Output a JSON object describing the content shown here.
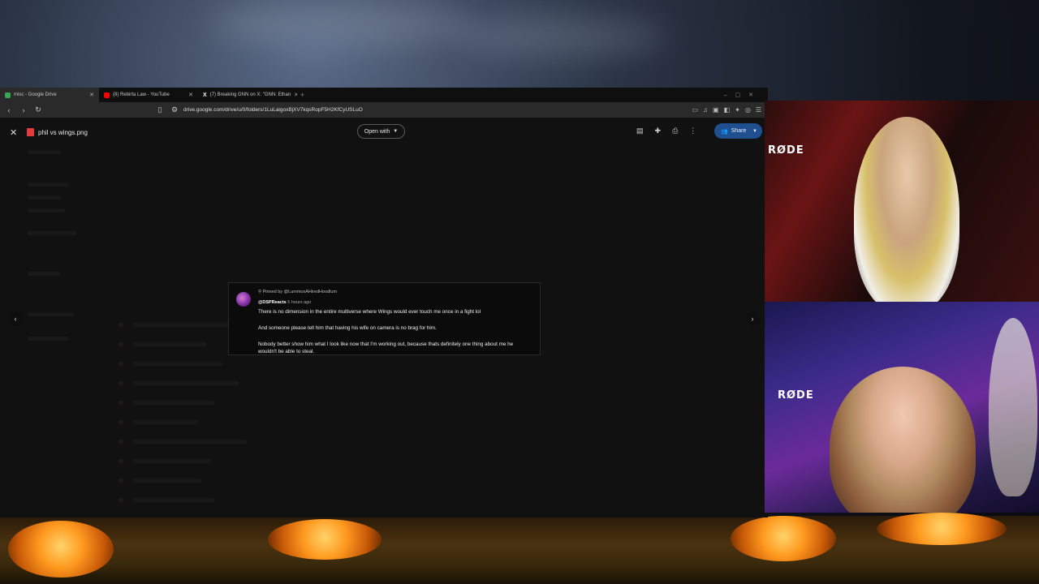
{
  "tabs": [
    {
      "label": "misc - Google Drive",
      "active": true,
      "favicon_color": "#34a853"
    },
    {
      "label": "(8) Rebirta Law - YouTube",
      "active": false,
      "favicon_color": "#ff0000"
    },
    {
      "label": "(7) Breaking GNN on X: \"GNN: Ethan",
      "active": false,
      "favicon_color": "#ffffff"
    }
  ],
  "address": {
    "url": "drive.google.com/drive/u/0/folders/1LuLaigoxBjXV7kqsRopF5H2KfCyUSLuO"
  },
  "preview": {
    "file_name": "phil vs wings.png",
    "open_with_label": "Open with",
    "share_label": "Share"
  },
  "comment": {
    "pinned_by": "Pinned by @LummoxAHiredHoodlum",
    "author": "@DSPReacts",
    "time": "5 hours ago",
    "line1": "There is no dimension in the entire multiverse where Wings would ever touch me once in a fight lol",
    "line2": "And someone please tell him that having his wife on camera is no brag for him.",
    "line3": "Nobody better show him what I look like now that I'm working out, because thats definitely one thing about me he",
    "line4": "wouldn't be able to steal."
  },
  "webcam": {
    "mic_brand": "RØDE"
  },
  "colors": {
    "share_button": "#1f4f8f",
    "accent_red": "#e33b3b"
  }
}
